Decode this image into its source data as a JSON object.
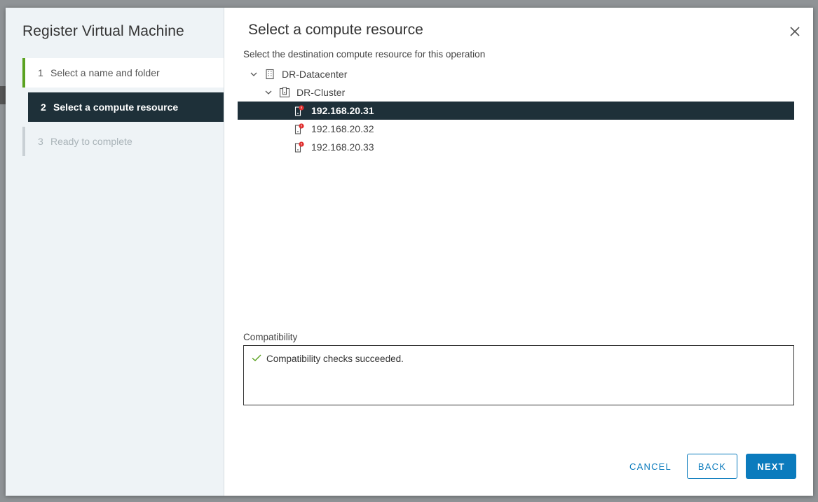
{
  "wizard": {
    "title": "Register Virtual Machine",
    "steps": [
      {
        "num": "1",
        "label": "Select a name and folder",
        "state": "done"
      },
      {
        "num": "2",
        "label": "Select a compute resource",
        "state": "active"
      },
      {
        "num": "3",
        "label": "Ready to complete",
        "state": "todo"
      }
    ]
  },
  "page": {
    "title": "Select a compute resource",
    "subtitle": "Select the destination compute resource for this operation"
  },
  "tree": {
    "datacenter": {
      "label": "DR-Datacenter",
      "icon": "datacenter-icon"
    },
    "cluster": {
      "label": "DR-Cluster",
      "icon": "cluster-icon"
    },
    "hosts": [
      {
        "label": "192.168.20.31",
        "selected": true,
        "icon": "host-warning-icon"
      },
      {
        "label": "192.168.20.32",
        "selected": false,
        "icon": "host-warning-icon"
      },
      {
        "label": "192.168.20.33",
        "selected": false,
        "icon": "host-warning-icon"
      }
    ]
  },
  "compatibility": {
    "label": "Compatibility",
    "message": "Compatibility checks succeeded."
  },
  "buttons": {
    "cancel": "CANCEL",
    "back": "BACK",
    "next": "NEXT"
  },
  "colors": {
    "accent": "#0b7bbd",
    "selected_bg": "#1e3039",
    "success": "#5aa220",
    "warning_badge": "#e02d2d"
  }
}
